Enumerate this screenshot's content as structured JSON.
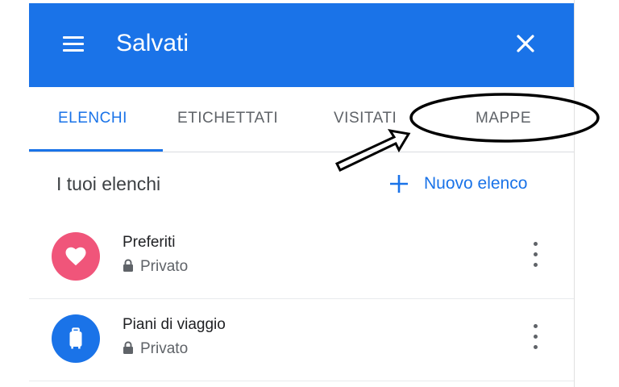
{
  "header": {
    "title": "Salvati",
    "menu_icon": "hamburger-menu-icon",
    "close_icon": "close-icon",
    "color": "#1a73e8"
  },
  "tabs": [
    {
      "label": "ELENCHI",
      "active": true
    },
    {
      "label": "ETICHETTATI",
      "active": false
    },
    {
      "label": "VISITATI",
      "active": false
    },
    {
      "label": "MAPPE",
      "active": false
    }
  ],
  "section": {
    "title": "I tuoi elenchi",
    "new_list_label": "Nuovo elenco"
  },
  "lists": [
    {
      "name": "Preferiti",
      "privacy": "Privato",
      "icon": "heart-icon",
      "color": "#f0557a"
    },
    {
      "name": "Piani di viaggio",
      "privacy": "Privato",
      "icon": "luggage-icon",
      "color": "#1a73e8"
    }
  ]
}
